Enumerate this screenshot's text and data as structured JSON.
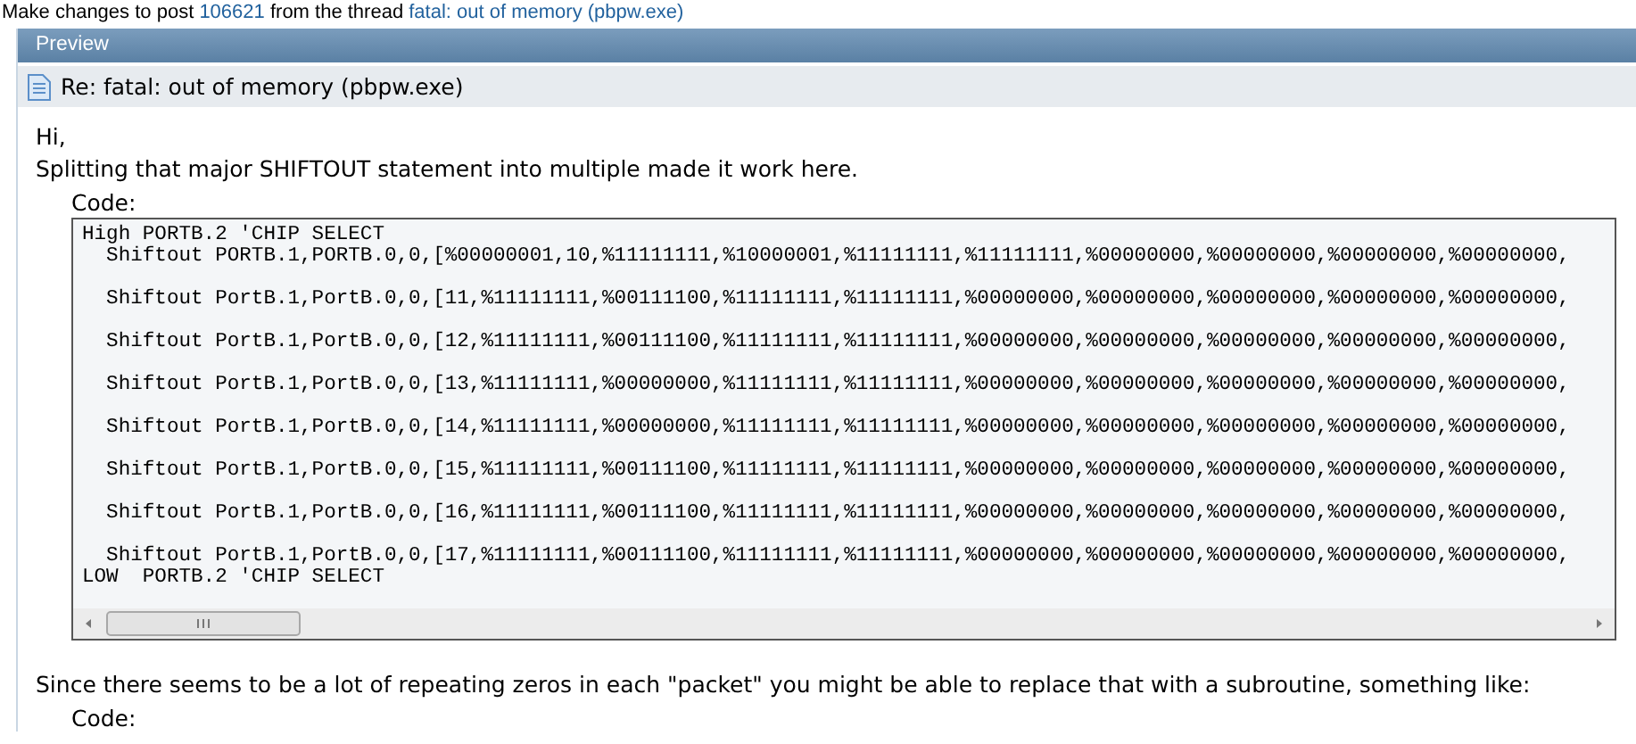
{
  "notice": {
    "before": "Make changes to post",
    "post_link": "106621",
    "middle": "from the thread",
    "thread_link": "fatal: out of memory (pbpw.exe)"
  },
  "preview": {
    "title": "Preview",
    "post_title": "Re: fatal: out of memory (pbpw.exe)",
    "blocks": [
      {
        "kind": "text",
        "lines": [
          "Hi,",
          "Splitting that major SHIFTOUT statement into multiple made it work here."
        ]
      },
      {
        "kind": "code",
        "label": "Code:",
        "code": "High PORTB.2 'CHIP SELECT\n  Shiftout PORTB.1,PORTB.0,0,[%00000001,10,%11111111,%10000001,%11111111,%11111111,%00000000,%00000000,%00000000,%00000000,\n\n  Shiftout PortB.1,PortB.0,0,[11,%11111111,%00111100,%11111111,%11111111,%00000000,%00000000,%00000000,%00000000,%00000000,\n\n  Shiftout PortB.1,PortB.0,0,[12,%11111111,%00111100,%11111111,%11111111,%00000000,%00000000,%00000000,%00000000,%00000000,\n\n  Shiftout PortB.1,PortB.0,0,[13,%11111111,%00000000,%11111111,%11111111,%00000000,%00000000,%00000000,%00000000,%00000000,\n\n  Shiftout PortB.1,PortB.0,0,[14,%11111111,%00000000,%11111111,%11111111,%00000000,%00000000,%00000000,%00000000,%00000000,\n\n  Shiftout PortB.1,PortB.0,0,[15,%11111111,%00111100,%11111111,%11111111,%00000000,%00000000,%00000000,%00000000,%00000000,\n\n  Shiftout PortB.1,PortB.0,0,[16,%11111111,%00111100,%11111111,%11111111,%00000000,%00000000,%00000000,%00000000,%00000000,\n\n  Shiftout PortB.1,PortB.0,0,[17,%11111111,%00111100,%11111111,%11111111,%00000000,%00000000,%00000000,%00000000,%00000000,\nLOW  PORTB.2 'CHIP SELECT"
      },
      {
        "kind": "text",
        "lines": [
          "Since there seems to be a lot of repeating zeros in each \"packet\" you might be able to replace that with a subroutine, something like:"
        ]
      },
      {
        "kind": "code",
        "label": "Code:"
      }
    ]
  }
}
